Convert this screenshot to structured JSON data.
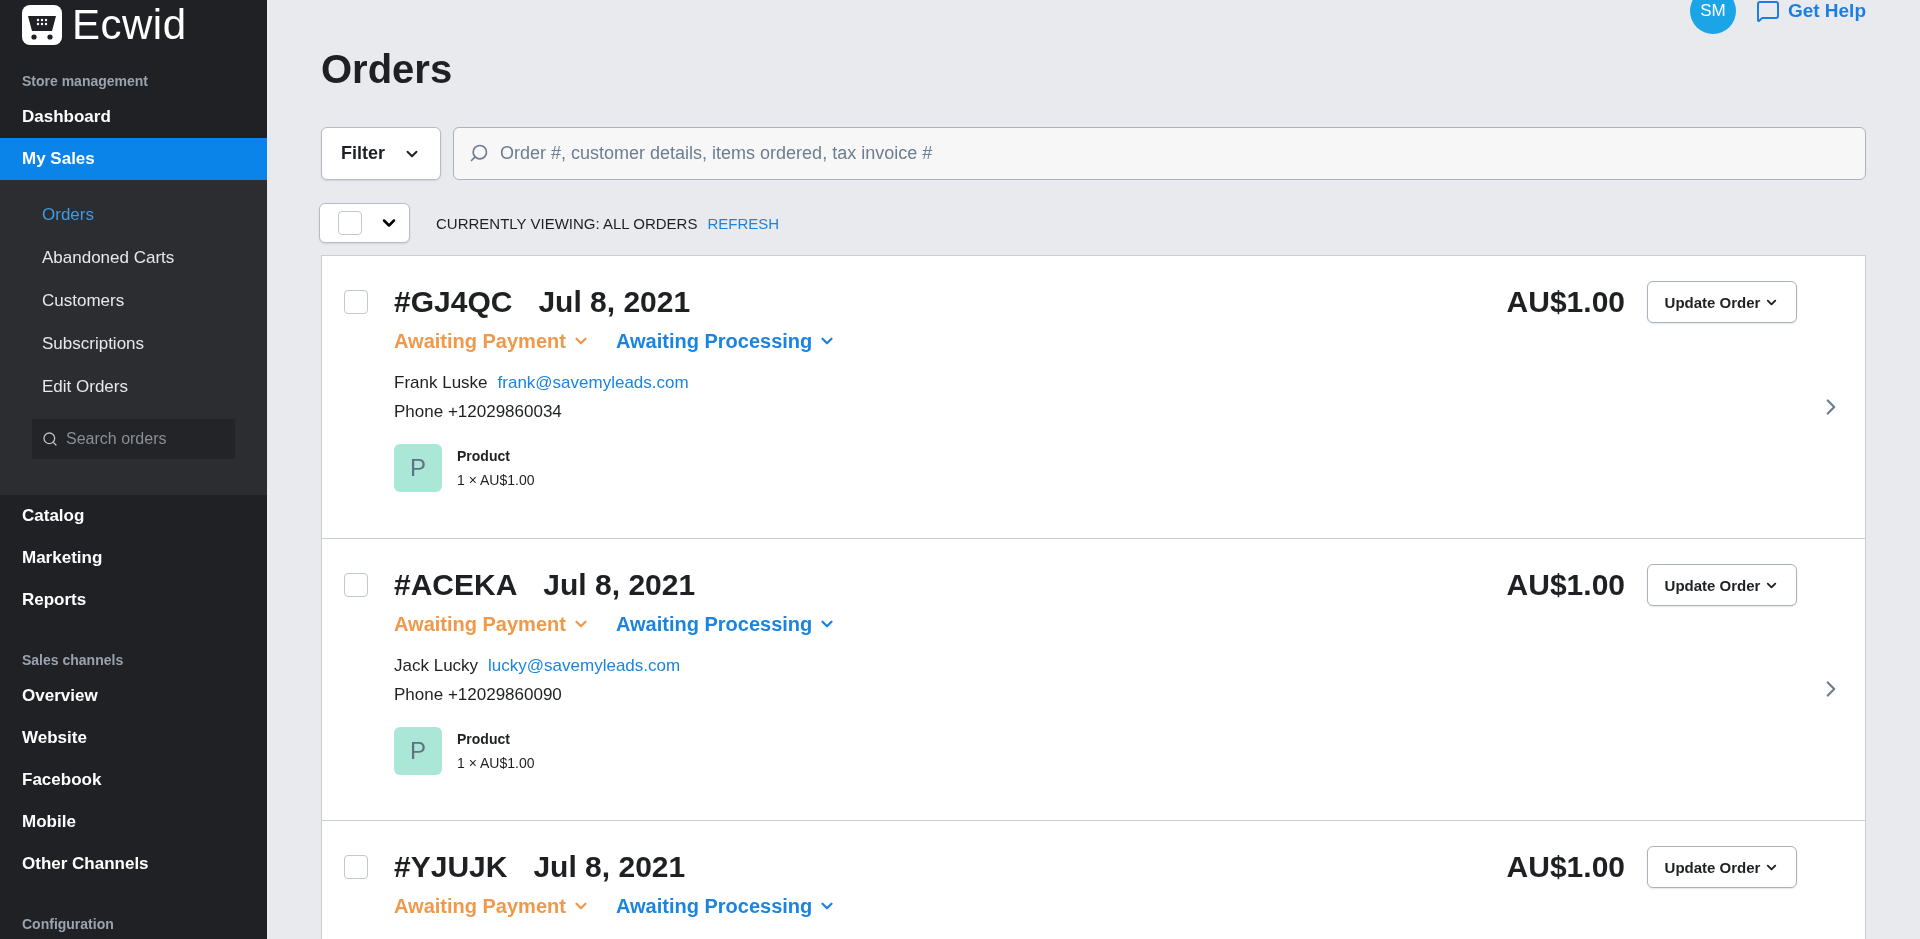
{
  "brand": {
    "name": "Ecwid"
  },
  "sidebar": {
    "sections": [
      {
        "heading": "Store management",
        "items": [
          {
            "label": "Dashboard",
            "selected": false
          },
          {
            "label": "My Sales",
            "selected": true,
            "children": [
              {
                "label": "Orders",
                "selected": true
              },
              {
                "label": "Abandoned Carts",
                "selected": false
              },
              {
                "label": "Customers",
                "selected": false
              },
              {
                "label": "Subscriptions",
                "selected": false
              },
              {
                "label": "Edit Orders",
                "selected": false
              }
            ],
            "search": {
              "placeholder": "Search orders"
            }
          },
          {
            "label": "Catalog",
            "selected": false
          },
          {
            "label": "Marketing",
            "selected": false
          },
          {
            "label": "Reports",
            "selected": false
          }
        ]
      },
      {
        "heading": "Sales channels",
        "items": [
          {
            "label": "Overview",
            "selected": false
          },
          {
            "label": "Website",
            "selected": false
          },
          {
            "label": "Facebook",
            "selected": false
          },
          {
            "label": "Mobile",
            "selected": false
          },
          {
            "label": "Other Channels",
            "selected": false
          }
        ]
      },
      {
        "heading": "Configuration"
      }
    ]
  },
  "header": {
    "avatar": "SM",
    "help": "Get Help"
  },
  "page_title": "Orders",
  "toolbar": {
    "filter": "Filter",
    "search": {
      "placeholder": "Order #, customer details, items ordered, tax invoice #"
    }
  },
  "selection": {
    "checked": false,
    "viewing": "CURRENTLY VIEWING: ALL ORDERS",
    "refresh": "REFRESH"
  },
  "orders": [
    {
      "checked": false,
      "number": "#GJ4QC",
      "date": "Jul 8, 2021",
      "total": "AU$1.00",
      "action": "Update Order",
      "payment_status": "Awaiting Payment",
      "fulfillment_status": "Awaiting Processing",
      "customer": "Frank Luske",
      "email": "frank@savemyleads.com",
      "phone": "Phone +12029860034",
      "items": [
        {
          "thumb": "P",
          "name": "Product",
          "quantity": "1 × AU$1.00"
        }
      ]
    },
    {
      "checked": false,
      "number": "#ACEKA",
      "date": "Jul 8, 2021",
      "total": "AU$1.00",
      "action": "Update Order",
      "payment_status": "Awaiting Payment",
      "fulfillment_status": "Awaiting Processing",
      "customer": "Jack Lucky",
      "email": "lucky@savemyleads.com",
      "phone": "Phone +12029860090",
      "items": [
        {
          "thumb": "P",
          "name": "Product",
          "quantity": "1 × AU$1.00"
        }
      ]
    },
    {
      "checked": false,
      "number": "#YJUJK",
      "date": "Jul 8, 2021",
      "total": "AU$1.00",
      "action": "Update Order",
      "payment_status": "Awaiting Payment",
      "fulfillment_status": "Awaiting Processing"
    }
  ]
}
